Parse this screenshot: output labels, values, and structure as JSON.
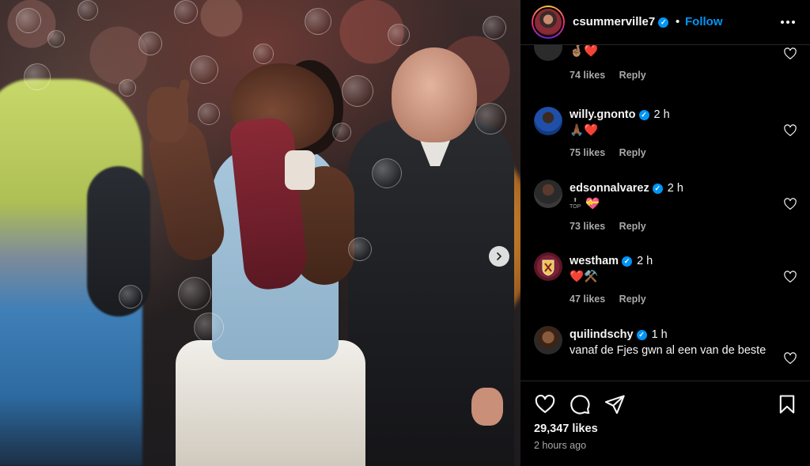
{
  "post": {
    "username": "csummerville7",
    "verified": true,
    "dot": "•",
    "follow_label": "Follow",
    "likes": "29,347 likes",
    "time_ago": "2 hours ago"
  },
  "comments": [
    {
      "username": "",
      "time": "",
      "text": "🤞🏽❤️",
      "likes": "74 likes",
      "reply_label": "Reply"
    },
    {
      "username": "willy.gnonto",
      "verified": true,
      "time": "2 h",
      "text": "🙏🏾❤️",
      "likes": "75 likes",
      "reply_label": "Reply"
    },
    {
      "username": "edsonnalvarez",
      "verified": true,
      "time": "2 h",
      "text": "💝",
      "badge": "TOP",
      "likes": "73 likes",
      "reply_label": "Reply"
    },
    {
      "username": "westham",
      "verified": true,
      "time": "2 h",
      "text": "❤️⚒️",
      "likes": "47 likes",
      "reply_label": "Reply"
    },
    {
      "username": "quilindschy",
      "verified": true,
      "time": "1 h",
      "text": "vanaf de Fjes gwn al een van de beste"
    }
  ],
  "icons": {
    "like": "heart-icon",
    "comment": "comment-icon",
    "share": "share-icon",
    "save": "bookmark-icon",
    "more": "more-icon",
    "next": "chevron-right-icon"
  },
  "colors": {
    "accent": "#0095f6",
    "text": "#f5f5f5",
    "muted": "#a8a8a8",
    "background": "#000000"
  }
}
